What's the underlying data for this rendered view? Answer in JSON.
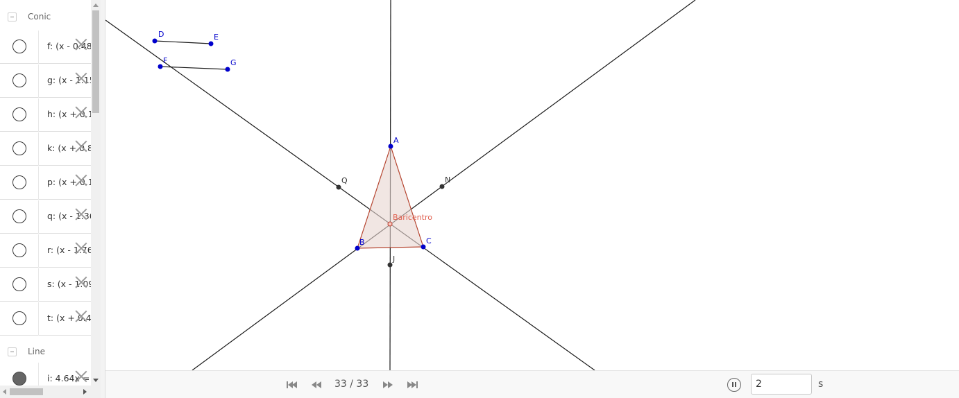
{
  "algebra": {
    "groups": [
      {
        "label": "Conic",
        "items": [
          {
            "text": "f: (x - 0.48",
            "filled": false
          },
          {
            "text": "g: (x - 1.15",
            "filled": false
          },
          {
            "text": "h: (x + 0.1",
            "filled": false
          },
          {
            "text": "k: (x + 0.8",
            "filled": false
          },
          {
            "text": "p: (x + 0.1",
            "filled": false
          },
          {
            "text": "q: (x - 1.36",
            "filled": false
          },
          {
            "text": "r: (x - 1.76",
            "filled": false
          },
          {
            "text": "s: (x - 1.09",
            "filled": false
          },
          {
            "text": "t: (x + 0.4",
            "filled": false
          }
        ]
      },
      {
        "label": "Line",
        "items": [
          {
            "text": "i: 4.64x =",
            "filled": true
          }
        ]
      }
    ]
  },
  "graphics": {
    "point_labels": {
      "A": "A",
      "B": "B",
      "C": "C",
      "D": "D",
      "E": "E",
      "F": "F",
      "G": "G",
      "J": "J",
      "N": "N",
      "Q": "Q",
      "centroid": "Baricentro"
    },
    "colors": {
      "point_blue": "#0000cc",
      "point_dark": "#333333",
      "triangle_fill": "#e8d5d0",
      "triangle_stroke": "#b5442f",
      "centroid_label": "#e06050"
    }
  },
  "animation": {
    "step": "33 / 33",
    "speed_value": "2",
    "speed_unit": "s"
  }
}
